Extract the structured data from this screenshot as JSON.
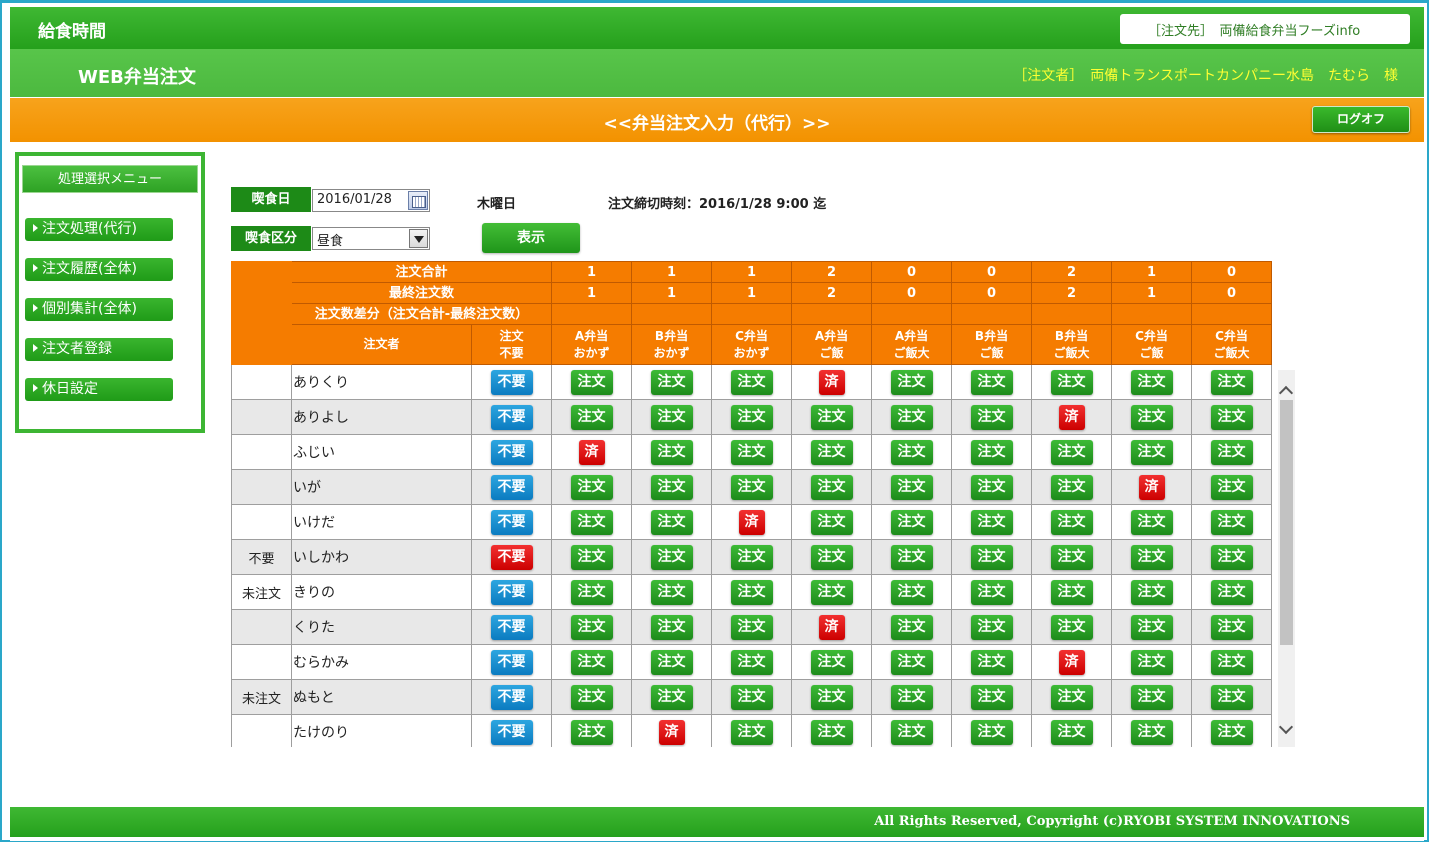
{
  "header": {
    "app_name": "給食時間",
    "vendor": "［注文先］　両備給食弁当フーズinfo",
    "system_title": "WEB弁当注文",
    "orderer": "［注文者］　両備トランスポートカンパニー水島　たむら　様",
    "page_title": "<<弁当注文入力（代行）>>",
    "logoff_label": "ログオフ"
  },
  "sidebar": {
    "title": "処理選択メニュー",
    "items": [
      {
        "label": "注文処理(代行)"
      },
      {
        "label": "注文履歴(全体)"
      },
      {
        "label": "個別集計(全体)"
      },
      {
        "label": "注文者登録"
      },
      {
        "label": "休日設定"
      }
    ]
  },
  "form": {
    "date_label": "喫食日",
    "date_value": "2016/01/28",
    "weekday": "木曜日",
    "deadline": "注文締切時刻：2016/1/28 9:00 迄",
    "meal_label": "喫食区分",
    "meal_value": "昼食",
    "show_label": "表示"
  },
  "summary": {
    "total_label": "注文合計",
    "final_label": "最終注文数",
    "diff_label": "注文数差分（注文合計-最終注文数）",
    "totals": [
      "1",
      "1",
      "1",
      "2",
      "0",
      "0",
      "2",
      "1",
      "0"
    ],
    "finals": [
      "1",
      "1",
      "1",
      "2",
      "0",
      "0",
      "2",
      "1",
      "0"
    ]
  },
  "columns": {
    "orderer": "注文者",
    "none": [
      "注文",
      "不要"
    ],
    "items": [
      [
        "A弁当",
        "おかず"
      ],
      [
        "B弁当",
        "おかず"
      ],
      [
        "C弁当",
        "おかず"
      ],
      [
        "A弁当",
        "ご飯"
      ],
      [
        "A弁当",
        "ご飯大"
      ],
      [
        "B弁当",
        "ご飯"
      ],
      [
        "B弁当",
        "ご飯大"
      ],
      [
        "C弁当",
        "ご飯"
      ],
      [
        "C弁当",
        "ご飯大"
      ]
    ]
  },
  "labels": {
    "none_button": "不要",
    "order_button": "注文",
    "done_button": "済"
  },
  "rows": [
    {
      "status": "",
      "name": "ありくり",
      "none_active": false,
      "done": [
        3
      ]
    },
    {
      "status": "",
      "name": "ありよし",
      "none_active": false,
      "done": [
        6
      ]
    },
    {
      "status": "",
      "name": "ふじい",
      "none_active": false,
      "done": [
        0
      ]
    },
    {
      "status": "",
      "name": "いが",
      "none_active": false,
      "done": [
        7
      ]
    },
    {
      "status": "",
      "name": "いけだ",
      "none_active": false,
      "done": [
        2
      ]
    },
    {
      "status": "不要",
      "name": "いしかわ",
      "none_active": true,
      "done": []
    },
    {
      "status": "未注文",
      "name": "きりの",
      "none_active": false,
      "done": []
    },
    {
      "status": "",
      "name": "くりた",
      "none_active": false,
      "done": [
        3
      ]
    },
    {
      "status": "",
      "name": "むらかみ",
      "none_active": false,
      "done": [
        6
      ]
    },
    {
      "status": "未注文",
      "name": "ぬもと",
      "none_active": false,
      "done": []
    },
    {
      "status": "",
      "name": "たけのり",
      "none_active": false,
      "done": [
        1
      ]
    }
  ],
  "footer": {
    "copyright": "All Rights Reserved, Copyright (c)RYOBI SYSTEM INNOVATIONS"
  }
}
